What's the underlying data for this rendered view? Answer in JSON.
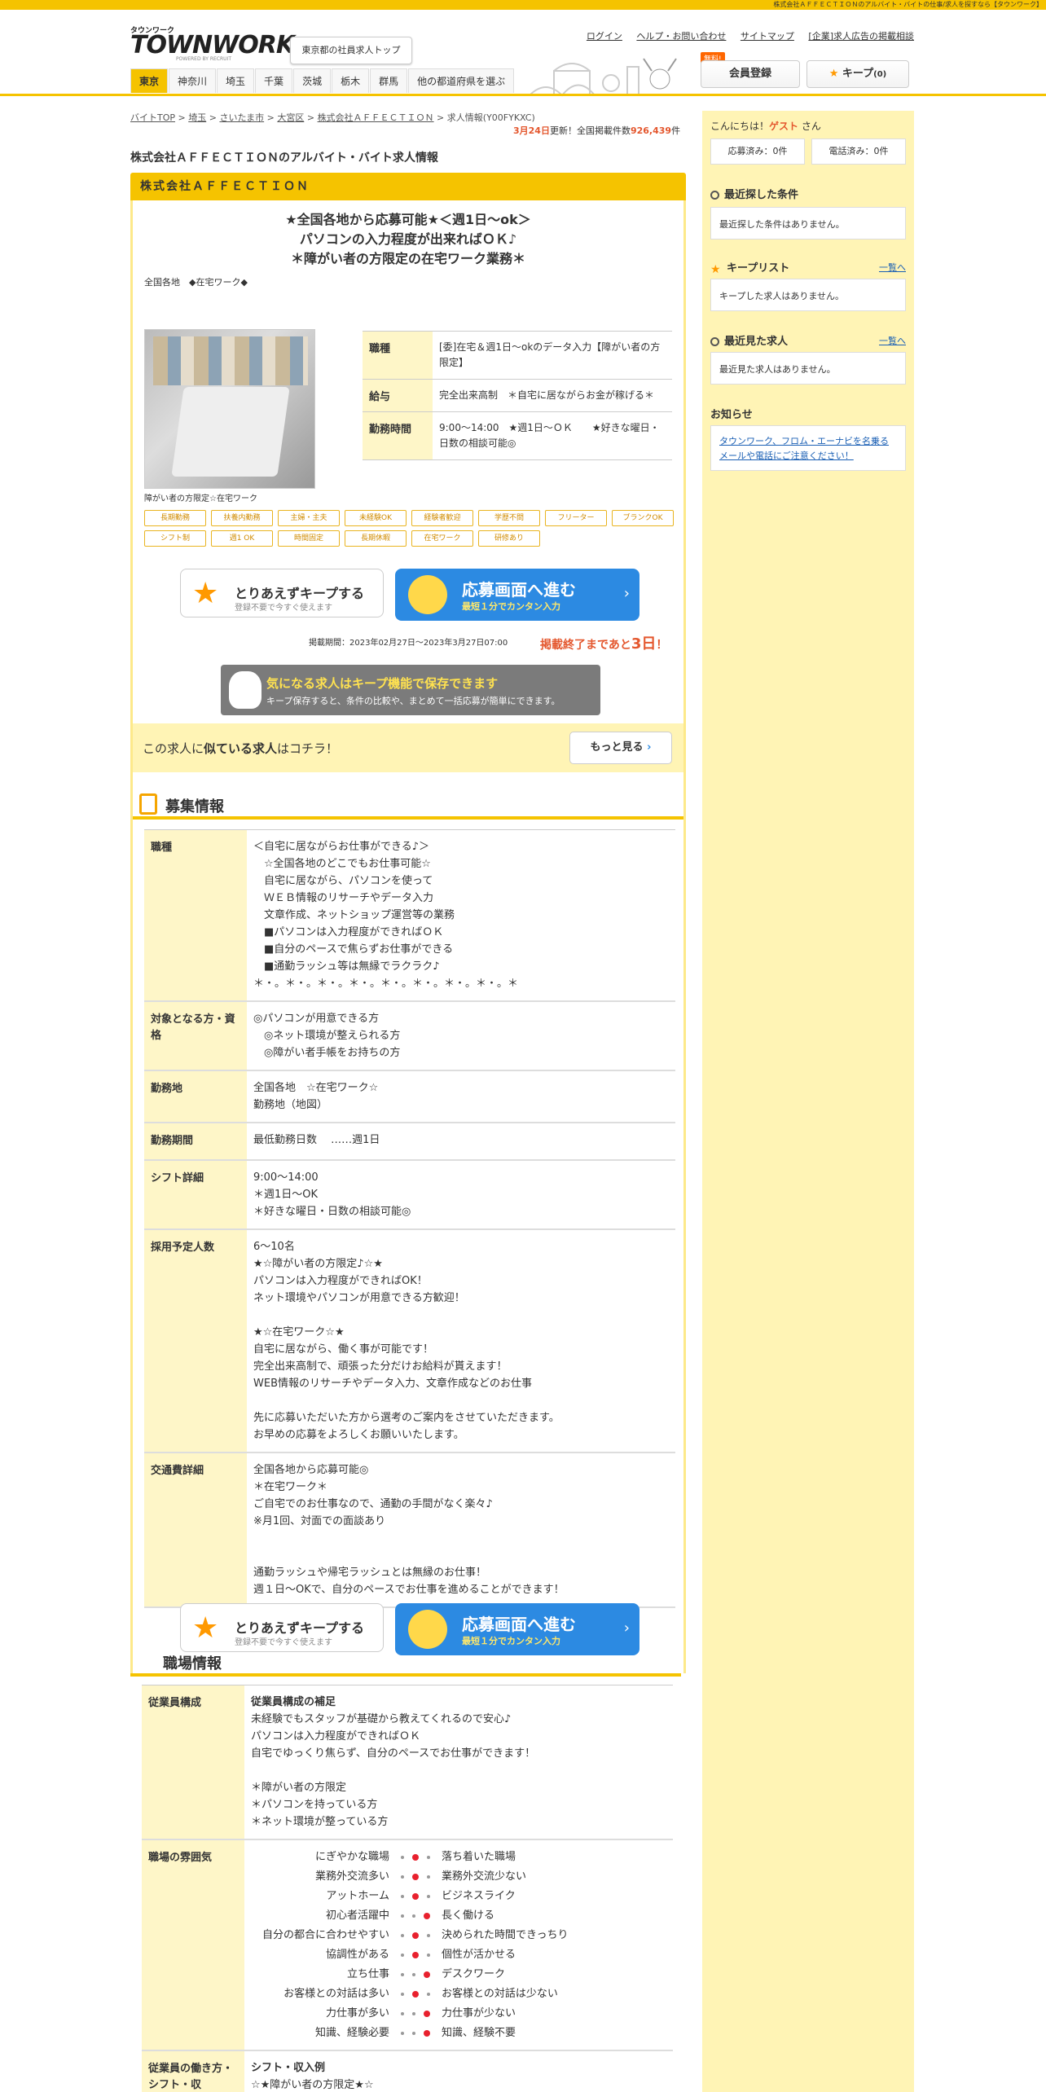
{
  "top_notice": "株式会社ＡＦＦＥＣＴＩＯＮのアルバイト・バイトの仕事/求人を探すなら【タウンワーク】",
  "logo": {
    "small": "タウンワーク",
    "big": "TOWNWORK",
    "powered": "POWERED BY RECRUIT"
  },
  "header": {
    "tokyo_btn": "東京都の社員求人トップ",
    "links": [
      "ログイン",
      "ヘルプ・お問い合わせ",
      "サイトマップ",
      "[企業]求人広告の掲載相談"
    ],
    "free_badge": "無料!",
    "register": "会員登録",
    "keep": "キープ",
    "keep_count": "(0)"
  },
  "nav": [
    "東京",
    "神奈川",
    "埼玉",
    "千葉",
    "茨城",
    "栃木",
    "群馬",
    "他の都道府県を選ぶ"
  ],
  "breadcrumb": [
    "バイトTOP",
    "埼玉",
    "さいたま市",
    "大宮区",
    "株式会社ＡＦＦＥＣＴＩＯＮ",
    "求人情報(Y00FYKXC)"
  ],
  "update": {
    "date": "3月24日",
    "updated": "更新！全国掲載件数",
    "count": "926,439",
    "unit": "件"
  },
  "page_title": "株式会社ＡＦＦＥＣＴＩＯＮのアルバイト・バイト求人情報",
  "company": "株式会社ＡＦＦＥＣＴＩＯＮ",
  "catch": [
    "★全国各地から応募可能★＜週1日～ok＞",
    "パソコンの入力程度が出来ればＯＫ♪",
    "＊障がい者の方限定の在宅ワーク業務＊"
  ],
  "location": "全国各地　◆在宅ワーク◆",
  "image_caption": "障がい者の方限定☆在宅ワーク",
  "info": [
    {
      "h": "職種",
      "v": "[委]在宅＆週1日～okのデータ入力【障がい者の方限定】"
    },
    {
      "h": "給与",
      "v": "完全出来高制　＊自宅に居ながらお金が稼げる＊"
    },
    {
      "h": "勤務時間",
      "v": "9:00～14:00　★週1日～ＯＫ　　★好きな曜日・日数の相談可能◎"
    }
  ],
  "tags": [
    "長期勤務",
    "扶養内勤務",
    "主婦・主夫",
    "未経験OK",
    "経験者歓迎",
    "学歴不問",
    "フリーター",
    "ブランクOK",
    "シフト制",
    "週1 OK",
    "時間固定",
    "長期休暇",
    "在宅ワーク",
    "研修あり"
  ],
  "cta": {
    "keep_title": "とりあえずキープする",
    "keep_sub": "登録不要で今すぐ使えます",
    "apply_title": "応募画面へ進む",
    "apply_sub": "最短１分でカンタン入力"
  },
  "period": "掲載期間：2023年02月27日～2023年3月27日07:00",
  "remain": {
    "pre": "掲載終了まであと",
    "days": "3日",
    "post": "！"
  },
  "keep_info": {
    "title": "気になる求人はキープ機能で保存できます",
    "sub": "キープ保存すると、条件の比較や、まとめて一括応募が簡単にできます。"
  },
  "similar": {
    "pre": "この求人に",
    "bold": "似ている求人",
    "post": "はコチラ！",
    "more": "もっと見る"
  },
  "recruit_title": "募集情報",
  "recruit": [
    {
      "h": "職種",
      "v": "＜自宅に居ながらお仕事ができる♪＞\n　☆全国各地のどこでもお仕事可能☆\n　自宅に居ながら、パソコンを使って\n　ＷＥＢ情報のリサーチやデータ入力\n　文章作成、ネットショップ運営等の業務\n　■パソコンは入力程度ができればＯＫ\n　■自分のペースで焦らずお仕事ができる\n　■通勤ラッシュ等は無縁でラクラク♪\n＊・。＊・。＊・。＊・。＊・。＊・。＊・。＊・。＊"
    },
    {
      "h": "対象となる方・資格",
      "v": "◎パソコンが用意できる方\n　◎ネット環境が整えられる方\n　◎障がい者手帳をお持ちの方"
    },
    {
      "h": "勤務地",
      "v": "全国各地　☆在宅ワーク☆\n勤務地（地図）"
    },
    {
      "h": "勤務期間",
      "v": "最低勤務日数　 ……週1日"
    },
    {
      "h": "シフト詳細",
      "v": "9:00～14:00\n＊週1日～OK\n＊好きな曜日・日数の相談可能◎"
    },
    {
      "h": "採用予定人数",
      "v": "6～10名\n★☆障がい者の方限定♪☆★\nパソコンは入力程度ができればOK！\nネット環境やパソコンが用意できる方歓迎！\n\n★☆在宅ワーク☆★\n自宅に居ながら、働く事が可能です！\n完全出来高制で、頑張った分だけお給料が貰えます！\nWEB情報のリサーチやデータ入力、文章作成などのお仕事\n\n先に応募いただいた方から選考のご案内をさせていただきます。\nお早めの応募をよろしくお願いいたします。"
    },
    {
      "h": "交通費詳細",
      "v": "全国各地から応募可能◎\n＊在宅ワーク＊\nご自宅でのお仕事なので、通勤の手間がなく楽々♪\n※月1回、対面での面談あり\n\n\n通勤ラッシュや帰宅ラッシュとは無縁のお仕事！\n週１日～OKで、自分のペースでお仕事を進めることができます！"
    }
  ],
  "workplace_title": "職場情報",
  "staff": {
    "h": "従業員構成",
    "sub": "従業員構成の補足",
    "v": "未経験でもスタッフが基礎から教えてくれるので安心♪\nパソコンは入力程度ができればＯＫ\n自宅でゆっくり焦らず、自分のペースでお仕事ができます！\n\n＊障がい者の方限定\n＊パソコンを持っている方\n＊ネット環境が整っている方"
  },
  "atmosphere": {
    "h": "職場の雰囲気",
    "rows": [
      {
        "l": "にぎやかな職場",
        "r": "落ち着いた職場",
        "pos": 2
      },
      {
        "l": "業務外交流多い",
        "r": "業務外交流少ない",
        "pos": 2
      },
      {
        "l": "アットホーム",
        "r": "ビジネスライク",
        "pos": 2
      },
      {
        "l": "初心者活躍中",
        "r": "長く働ける",
        "pos": 3
      },
      {
        "l": "自分の都合に合わせやすい",
        "r": "決められた時間できっちり",
        "pos": 2
      },
      {
        "l": "協調性がある",
        "r": "個性が活かせる",
        "pos": 2
      },
      {
        "l": "立ち仕事",
        "r": "デスクワーク",
        "pos": 3
      },
      {
        "l": "お客様との対話は多い",
        "r": "お客様との対話は少ない",
        "pos": 2
      },
      {
        "l": "力仕事が多い",
        "r": "力仕事が少ない",
        "pos": 3
      },
      {
        "l": "知識、経験必要",
        "r": "知識、経験不要",
        "pos": 3
      }
    ]
  },
  "workstyle": {
    "h": "従業員の働き方・シフト・収",
    "sub": "シフト・収入例",
    "v": "☆★障がい者の方限定★☆"
  },
  "side": {
    "greet_pre": "こんにちは！",
    "guest": "ゲスト",
    "greet_post": "さん",
    "applied": "応募済み：0件",
    "called": "電話済み：0件",
    "recent_cond": "最近探した条件",
    "recent_cond_empty": "最近探した条件はありません。",
    "keeplist": "キープリスト",
    "keeplist_link": "一覧へ",
    "keeplist_empty": "キープした求人はありません。",
    "recent_job": "最近見た求人",
    "recent_job_link": "一覧へ",
    "recent_job_empty": "最近見た求人はありません。",
    "notice_title": "お知らせ",
    "notice": "タウンワーク、フロム・エーナビを名乗るメールや電話にご注意ください！"
  }
}
